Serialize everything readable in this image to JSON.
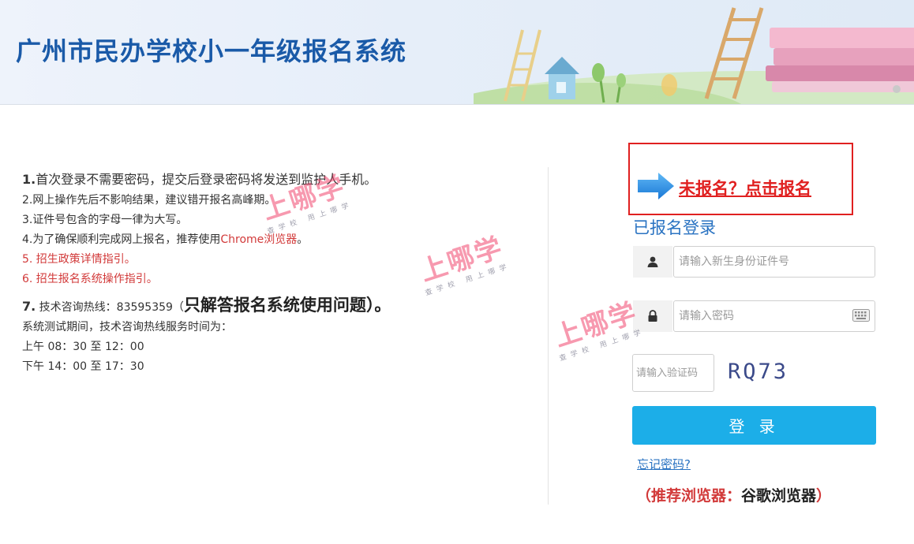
{
  "header": {
    "title": "广州市民办学校小一年级报名系统"
  },
  "info": {
    "line1_num": "1.",
    "line1_text": "首次登录不需要密码，提交后登录密码将发送到监护人手机。",
    "line2": "2.网上操作先后不影响结果，建议错开报名高峰期。",
    "line3": "3.证件号包含的字母一律为大写。",
    "line4_text": "4.为了确保顺利完成网上报名，推荐使用",
    "line4_link": "Chrome浏览器",
    "line4_end": "。",
    "line5": "5. 招生政策详情指引。",
    "line6": "6. 招生报名系统操作指引。",
    "line7_num": "7.",
    "line7_text": " 技术咨询热线：83595359（",
    "line7_big": "只解答报名系统使用问题",
    "line7_end": "）。",
    "line8": "系统测试期间，技术咨询热线服务时间为：",
    "line9": "上午 08：30 至 12：00",
    "line10": "下午 14：00 至 17：30"
  },
  "login": {
    "register_link": "未报名？点击报名",
    "heading": "已报名登录",
    "id_placeholder": "请输入新生身份证件号",
    "password_placeholder": "请输入密码",
    "captcha_placeholder": "请输入验证码",
    "captcha_code": "RQ73",
    "login_button": "登 录",
    "forgot_password": "忘记密码?",
    "browser_tip_open": "（",
    "browser_tip_label": "推荐浏览器：",
    "browser_tip_value": "谷歌浏览器",
    "browser_tip_close": "）"
  },
  "watermark": {
    "main": "上哪学",
    "sub": "查学校 用上哪学"
  },
  "colors": {
    "brand_blue": "#1a5aa8",
    "button_blue": "#1caee8",
    "alert_red": "#e02020",
    "link_blue": "#2a73c2"
  }
}
